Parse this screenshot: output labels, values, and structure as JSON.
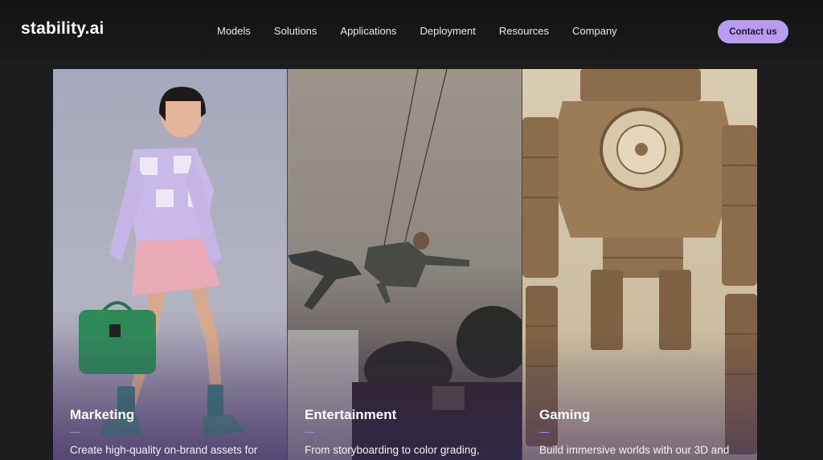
{
  "header": {
    "logo": "stability.ai",
    "nav": [
      "Models",
      "Solutions",
      "Applications",
      "Deployment",
      "Resources",
      "Company"
    ],
    "contact_label": "Contact us",
    "accent_color": "#b79cf2"
  },
  "cards": [
    {
      "title": "Marketing",
      "desc": "Create high-quality on-brand assets for"
    },
    {
      "title": "Entertainment",
      "desc": "From storyboarding to color grading,"
    },
    {
      "title": "Gaming",
      "desc": "Build immersive worlds with our 3D and"
    }
  ]
}
